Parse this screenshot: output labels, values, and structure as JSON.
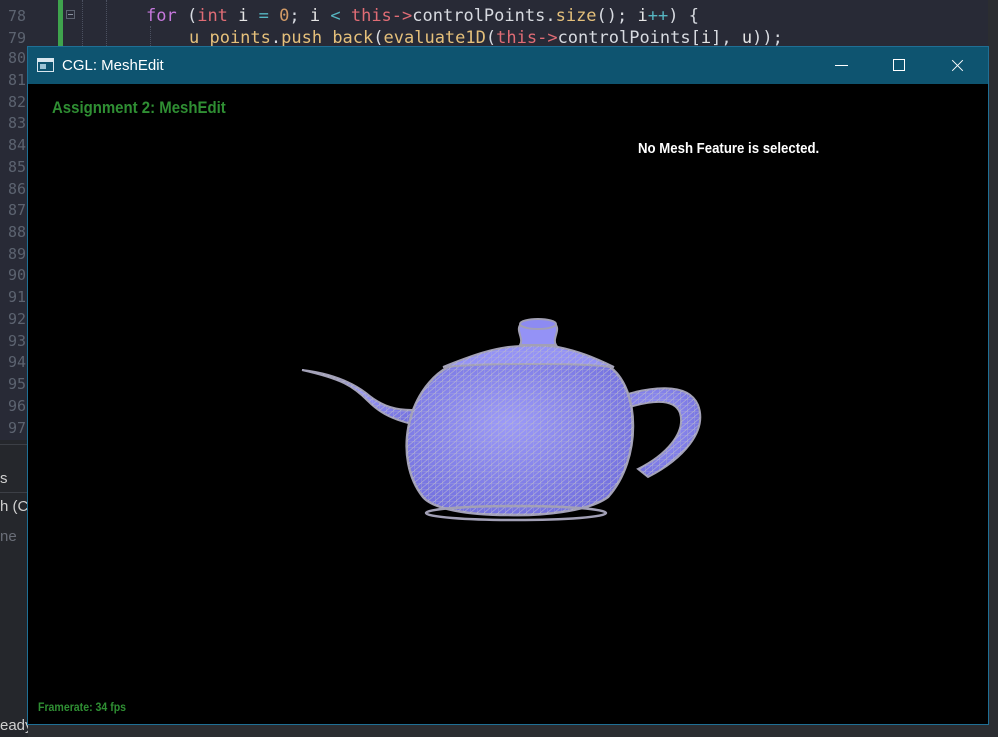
{
  "editor": {
    "line_numbers": [
      "78",
      "79",
      "80",
      "81",
      "82",
      "83",
      "84",
      "85",
      "86",
      "87",
      "88",
      "89",
      "90",
      "91",
      "92",
      "93",
      "94",
      "95",
      "96",
      "97"
    ],
    "code": {
      "line1": {
        "kw_for": "for",
        "paren": " (",
        "kw_int": "int",
        "sp1": " ",
        "var_i1": "i",
        "eq": " = ",
        "zero": "0",
        "semi1": "; ",
        "var_i2": "i",
        "lt": " < ",
        "kw_this1": "this",
        "arrow1": "->",
        "member1": "controlPoints",
        "dot1": ".",
        "fn_size": "size",
        "call1": "(); ",
        "var_i3": "i",
        "inc": "++",
        "close1": ") {"
      },
      "line2": {
        "var_u": "u_points",
        "dot": ".",
        "fn_push": "push_back",
        "open": "(",
        "fn_eval": "evaluate1D",
        "open2": "(",
        "kw_this": "this",
        "arrow": "->",
        "member": "controlPoints",
        "bracket": "[",
        "idx": "i",
        "bracket_close": "], ",
        "arg_u": "u",
        "close": "));"
      }
    }
  },
  "side_panel": {
    "items": [
      "s",
      "h (C",
      "ne",
      "eady"
    ]
  },
  "window": {
    "title": "CGL: MeshEdit",
    "icon": "window-app-icon",
    "buttons": {
      "minimize": "minimize-icon",
      "maximize": "maximize-icon",
      "close": "close-icon"
    }
  },
  "viewport": {
    "assignment_title": "Assignment 2: MeshEdit",
    "selection_status": "No Mesh Feature is selected.",
    "framerate": "Framerate: 34 fps",
    "mesh": "teapot"
  },
  "colors": {
    "titlebar": "#0e5470",
    "accent_green": "#2f8f33",
    "mesh_fill": "#8e8cf4",
    "mesh_wire": "#b8b8d0",
    "mesh_outline": "#a2a0b6"
  }
}
